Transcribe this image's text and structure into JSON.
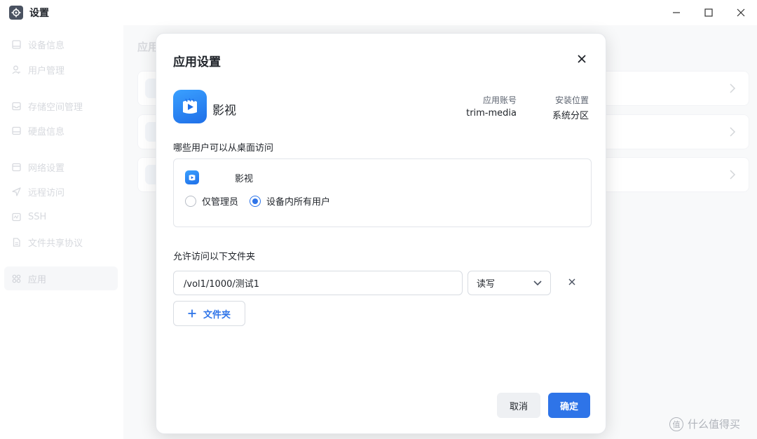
{
  "window": {
    "title": "设置"
  },
  "sidebar": {
    "items": [
      {
        "label": "设备信息",
        "icon": "monitor-icon"
      },
      {
        "label": "用户管理",
        "icon": "user-icon"
      },
      {
        "label": "存储空间管理",
        "icon": "storage-icon"
      },
      {
        "label": "硬盘信息",
        "icon": "disk-icon"
      },
      {
        "label": "网络设置",
        "icon": "network-icon"
      },
      {
        "label": "远程访问",
        "icon": "send-icon"
      },
      {
        "label": "SSH",
        "icon": "terminal-icon"
      },
      {
        "label": "文件共享协议",
        "icon": "file-icon"
      },
      {
        "label": "应用",
        "icon": "apps-grid-icon",
        "active": true
      }
    ]
  },
  "background": {
    "title": "应用"
  },
  "dialog": {
    "title": "应用设置",
    "app": {
      "name": "影视",
      "account_label": "应用账号",
      "account_value": "trim-media",
      "location_label": "安装位置",
      "location_value": "系统分区"
    },
    "desktop_access": {
      "label": "哪些用户可以从桌面访问",
      "app_name": "影视",
      "options": [
        "仅管理员",
        "设备内所有用户"
      ],
      "selected": "设备内所有用户"
    },
    "folders": {
      "label": "允许访问以下文件夹",
      "rows": [
        {
          "path": "/vol1/1000/测试1",
          "permission": "读写"
        }
      ],
      "add_label": "文件夹"
    },
    "cancel_label": "取消",
    "ok_label": "确定"
  },
  "watermark": {
    "badge": "值",
    "text": "什么值得买"
  },
  "colors": {
    "accent": "#2e74e8",
    "app_icon": "#1f6fe8"
  }
}
